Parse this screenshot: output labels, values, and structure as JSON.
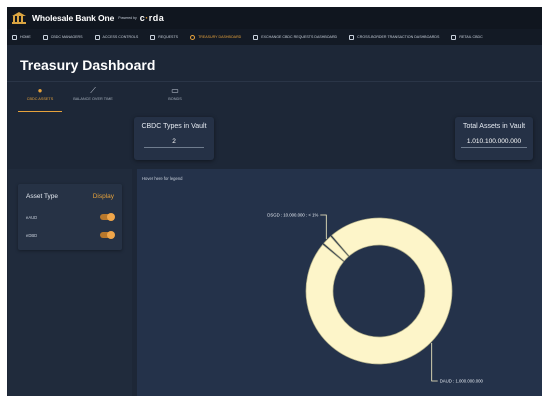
{
  "header": {
    "brand": "Wholesale Bank One",
    "powered_by": "Powered by",
    "powered_logo_main": "c",
    "powered_logo_accent": "·",
    "powered_logo_rest": "rda"
  },
  "nav": [
    {
      "label": "Home",
      "icon": "grid-icon",
      "active": false
    },
    {
      "label": "CBDC Managers",
      "icon": "id-card-icon",
      "active": false
    },
    {
      "label": "Access Controls",
      "icon": "shield-icon",
      "active": false
    },
    {
      "label": "Requests",
      "icon": "arrows-icon",
      "active": false
    },
    {
      "label": "Treasury Dashboard",
      "icon": "refresh-icon",
      "active": true
    },
    {
      "label": "Exchange CBDC Requests Dashboard",
      "icon": "exchange-icon",
      "active": false
    },
    {
      "label": "Cross-Border Transaction Dashboards",
      "icon": "globe-icon",
      "active": false
    },
    {
      "label": "Retail CBDC",
      "icon": "store-icon",
      "active": false
    }
  ],
  "page": {
    "title": "Treasury Dashboard"
  },
  "tabs": [
    {
      "label": "CBDC Assets",
      "icon": "coin-icon",
      "glyph": "●",
      "active": true
    },
    {
      "label": "Balance Over Time",
      "icon": "trend-icon",
      "glyph": "⟋",
      "active": false
    },
    {
      "label": "Bonds",
      "icon": "bond-icon",
      "glyph": "▭",
      "active": false
    }
  ],
  "stats": {
    "types_label": "CBDC Types in Vault",
    "types_value": "2",
    "total_label": "Total Assets in Vault",
    "total_value": "1.010.100.000.000"
  },
  "filter": {
    "asset_type_label": "Asset Type",
    "display_label": "Display",
    "assets": [
      {
        "name": "eAUD",
        "enabled": true
      },
      {
        "name": "eDBD",
        "enabled": true
      }
    ]
  },
  "chart": {
    "hint": "Hover here for legend",
    "accent_color": "#fdf5c9",
    "slice_stroke": "#b3b08a"
  },
  "chart_data": {
    "type": "pie",
    "style": "donut",
    "slices": [
      {
        "label": "DAUD",
        "value": 1000000000000,
        "label_text": "DAUD : 1.000.000.000"
      },
      {
        "label": "DSGD",
        "value": 10000000000,
        "label_text": "DSGD : 10.000.000 : < 1%"
      }
    ]
  }
}
